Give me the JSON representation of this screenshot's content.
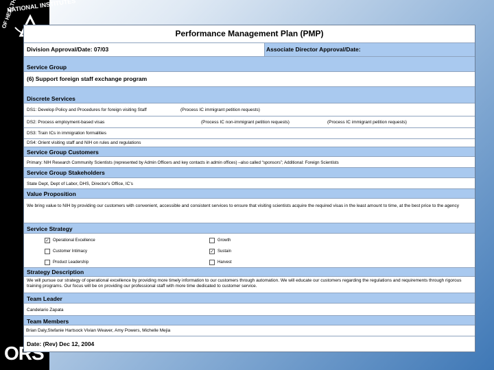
{
  "branding": {
    "seal_text_top": "NATIONAL INSTITUTES",
    "seal_text_left": "OF HEALTH",
    "logo": "ORS"
  },
  "plan": {
    "title": "Performance Management Plan (PMP)",
    "division_approval": "Division Approval/Date:  07/03",
    "associate_director_approval": "Associate Director Approval/Date:",
    "service_group_header": "Service Group",
    "service_group_value": "(6) Support foreign staff exchange program",
    "discrete_services_header": "Discrete Services",
    "ds1": "DS1: Develop Policy and Procedures for foreign visiting Staff",
    "ds1_note": "(Process IC immigrant petition requests)",
    "ds2": "DS2: Process employment-based visas",
    "ds2_note1": "(Process IC non-immigrant petition requests)",
    "ds2_note2": "(Process IC immigrant petition requests)",
    "ds3": "DS3:  Train ICs in immigration formalities",
    "ds4": "DS4: Orient visiting staff and NIH on rules and regulations",
    "customers_header": "Service Group Customers",
    "customers_value": "Primary: NIH Research Community Scientists (represented by Admin Officers and key contacts in admin offices) –also called “sponsors”; Additional: Foreign Scientists",
    "stakeholders_header": "Service Group Stakeholders",
    "stakeholders_value": "State Dept, Dept of Labor, DHS, Director's Office, IC's",
    "value_prop_header": "Value Proposition",
    "value_prop_value": "We bring value to NIH by providing our customers with convenient, accessible and consistent services to ensure that visiting scientists acquire the required visas in the least amount to time, at the best price to the agency",
    "strategy_header": "Service Strategy",
    "strategy_options": [
      {
        "label": "Operational Excellence",
        "checked": true
      },
      {
        "label": "Growth",
        "checked": false
      },
      {
        "label": "Customer Intimacy",
        "checked": false
      },
      {
        "label": "Sustain",
        "checked": true
      },
      {
        "label": "Product Leadership",
        "checked": false
      },
      {
        "label": "Harvest",
        "checked": false
      }
    ],
    "strategy_desc_header": "Strategy Description",
    "strategy_desc_value": "We will pursue our strategy of operational excellence by providing more timely information to our customers through automation. We will educate our customers regarding the regulations and requirements through rigorous training programs. Our focus will be on providing our professional staff with more time dedicated to customer service.",
    "team_leader_header": "Team Leader",
    "team_leader_value": "Candelario Zapata",
    "team_members_header": "Team Members",
    "team_members_value": " Brian Daly,Stefanie Hartsock Vivian Weaver, Amy Powers, Michelle Mejia",
    "date_line": "Date: (Rev) Dec 12, 2004"
  }
}
